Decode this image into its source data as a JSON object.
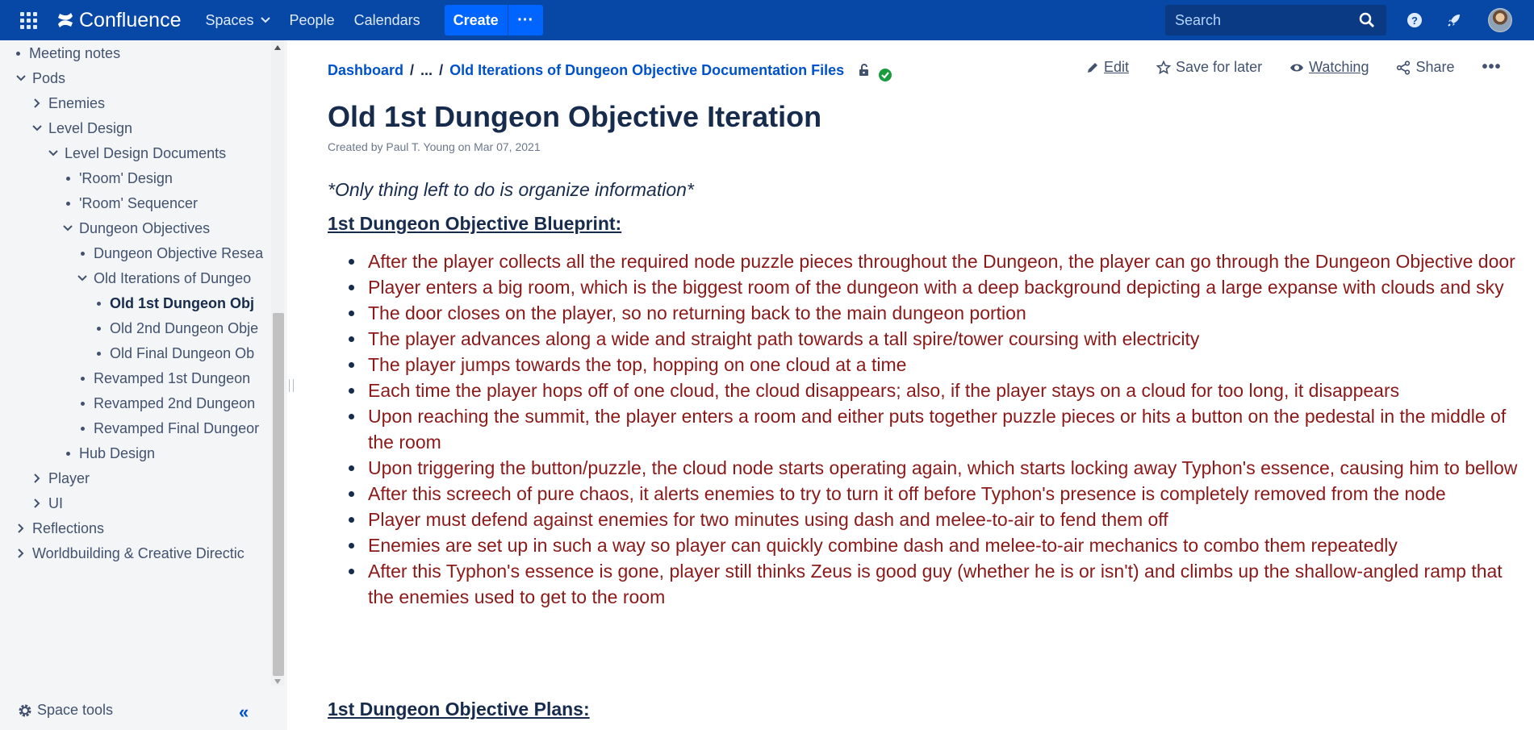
{
  "topnav": {
    "app_name": "Confluence",
    "spaces": "Spaces",
    "people": "People",
    "calendars": "Calendars",
    "create": "Create",
    "more": "···",
    "search_placeholder": "Search"
  },
  "sidebar": {
    "items": [
      {
        "label": "Meeting notes",
        "level": 1,
        "kind": "bullet"
      },
      {
        "label": "Pods",
        "level": 0,
        "kind": "expanded"
      },
      {
        "label": "Enemies",
        "level": 1,
        "kind": "collapsed"
      },
      {
        "label": "Level Design",
        "level": 1,
        "kind": "expanded"
      },
      {
        "label": "Level Design Documents",
        "level": 2,
        "kind": "expanded"
      },
      {
        "label": "'Room' Design",
        "level": 3,
        "kind": "bullet"
      },
      {
        "label": "'Room' Sequencer",
        "level": 3,
        "kind": "bullet"
      },
      {
        "label": "Dungeon Objectives",
        "level": 3,
        "kind": "expanded"
      },
      {
        "label": "Dungeon Objective Resea",
        "level": 4,
        "kind": "bullet"
      },
      {
        "label": "Old Iterations of Dungeo",
        "level": 4,
        "kind": "expanded"
      },
      {
        "label": "Old 1st Dungeon Obj",
        "level": 5,
        "kind": "bullet",
        "active": true
      },
      {
        "label": "Old 2nd Dungeon Obje",
        "level": 5,
        "kind": "bullet"
      },
      {
        "label": "Old Final Dungeon Ob",
        "level": 5,
        "kind": "bullet"
      },
      {
        "label": "Revamped 1st Dungeon",
        "level": 4,
        "kind": "bullet"
      },
      {
        "label": "Revamped 2nd Dungeon",
        "level": 4,
        "kind": "bullet"
      },
      {
        "label": "Revamped Final Dungeor",
        "level": 4,
        "kind": "bullet"
      },
      {
        "label": "Hub Design",
        "level": 3,
        "kind": "bullet"
      },
      {
        "label": "Player",
        "level": 1,
        "kind": "collapsed"
      },
      {
        "label": "UI",
        "level": 1,
        "kind": "collapsed"
      },
      {
        "label": "Reflections",
        "level": 0,
        "kind": "collapsed"
      },
      {
        "label": "Worldbuilding & Creative Directic",
        "level": 0,
        "kind": "collapsed"
      }
    ],
    "space_tools": "Space tools",
    "collapse": "«"
  },
  "breadcrumb": {
    "dashboard": "Dashboard",
    "ellipsis": "...",
    "parent": "Old Iterations of Dungeon Objective Documentation Files"
  },
  "actions": {
    "edit": "Edit",
    "save_for_later": "Save for later",
    "watching": "Watching",
    "share": "Share",
    "more": "•••"
  },
  "page": {
    "title": "Old 1st Dungeon Objective Iteration",
    "byline": "Created by Paul T. Young on Mar 07, 2021",
    "note": "*Only thing left to do is organize information*",
    "blueprint_heading": "1st Dungeon Objective Blueprint:",
    "blueprint_items": [
      "After the player collects all the required node puzzle pieces throughout the Dungeon, the player can go through the Dungeon Objective door",
      "Player enters a big room, which is the biggest room of the dungeon with a deep background depicting a large expanse with clouds and sky",
      "The door closes on the player, so no returning back to the main dungeon portion",
      "The player advances along a wide and straight path towards a tall spire/tower coursing with electricity",
      "The player jumps towards the top, hopping on one cloud at a time",
      "Each time the player hops off of one cloud, the cloud disappears; also, if the player stays on a cloud for too long, it disappears",
      "Upon reaching the summit, the player enters a room and either puts together puzzle pieces or hits a button on the pedestal in the middle of the room",
      "Upon triggering the button/puzzle, the cloud node starts operating again, which starts locking away Typhon's essence, causing him to bellow",
      "After this screech of pure chaos, it alerts enemies to try to turn it off before Typhon's presence is completely removed from the node",
      "Player must defend against enemies for two minutes using dash and melee-to-air to fend them off",
      "Enemies are set up in such a way so player can quickly combine dash and melee-to-air mechanics to combo them repeatedly",
      "After this Typhon's essence is gone, player still thinks Zeus is good guy (whether he is or isn't) and climbs up the shallow-angled ramp that the enemies used to get to the room"
    ],
    "plans_heading": "1st Dungeon Objective Plans:"
  },
  "colors": {
    "nav_bg": "#0747a6",
    "create_bg": "#0065ff",
    "link": "#0052cc",
    "list_text": "#8b1919",
    "sidebar_bg": "#f4f5f7",
    "success": "#36b37e"
  }
}
